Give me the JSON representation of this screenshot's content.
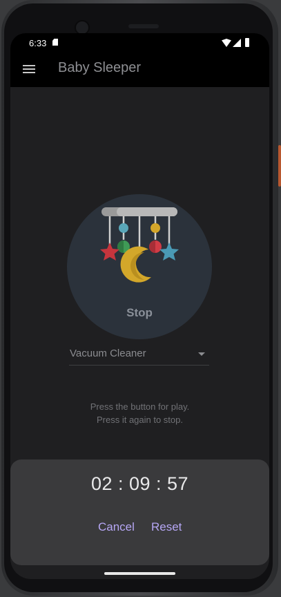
{
  "status_bar": {
    "time": "6:33"
  },
  "app_bar": {
    "title": "Baby Sleeper"
  },
  "player": {
    "button_label": "Stop"
  },
  "sound_selector": {
    "selected": "Vacuum Cleaner"
  },
  "instructions": {
    "line1": "Press the button for play.",
    "line2": "Press it again to stop."
  },
  "timer": {
    "display": "02 : 09 : 57",
    "cancel_label": "Cancel",
    "reset_label": "Reset"
  },
  "colors": {
    "background": "#1f1f21",
    "app_bar": "#000000",
    "button_circle": "#2b323b",
    "timer_sheet": "#3a3a3c",
    "accent": "#b6a7f5"
  },
  "icons": {
    "menu": "hamburger-icon",
    "player": "baby-mobile-icon",
    "dropdown": "dropdown-arrow-icon"
  }
}
